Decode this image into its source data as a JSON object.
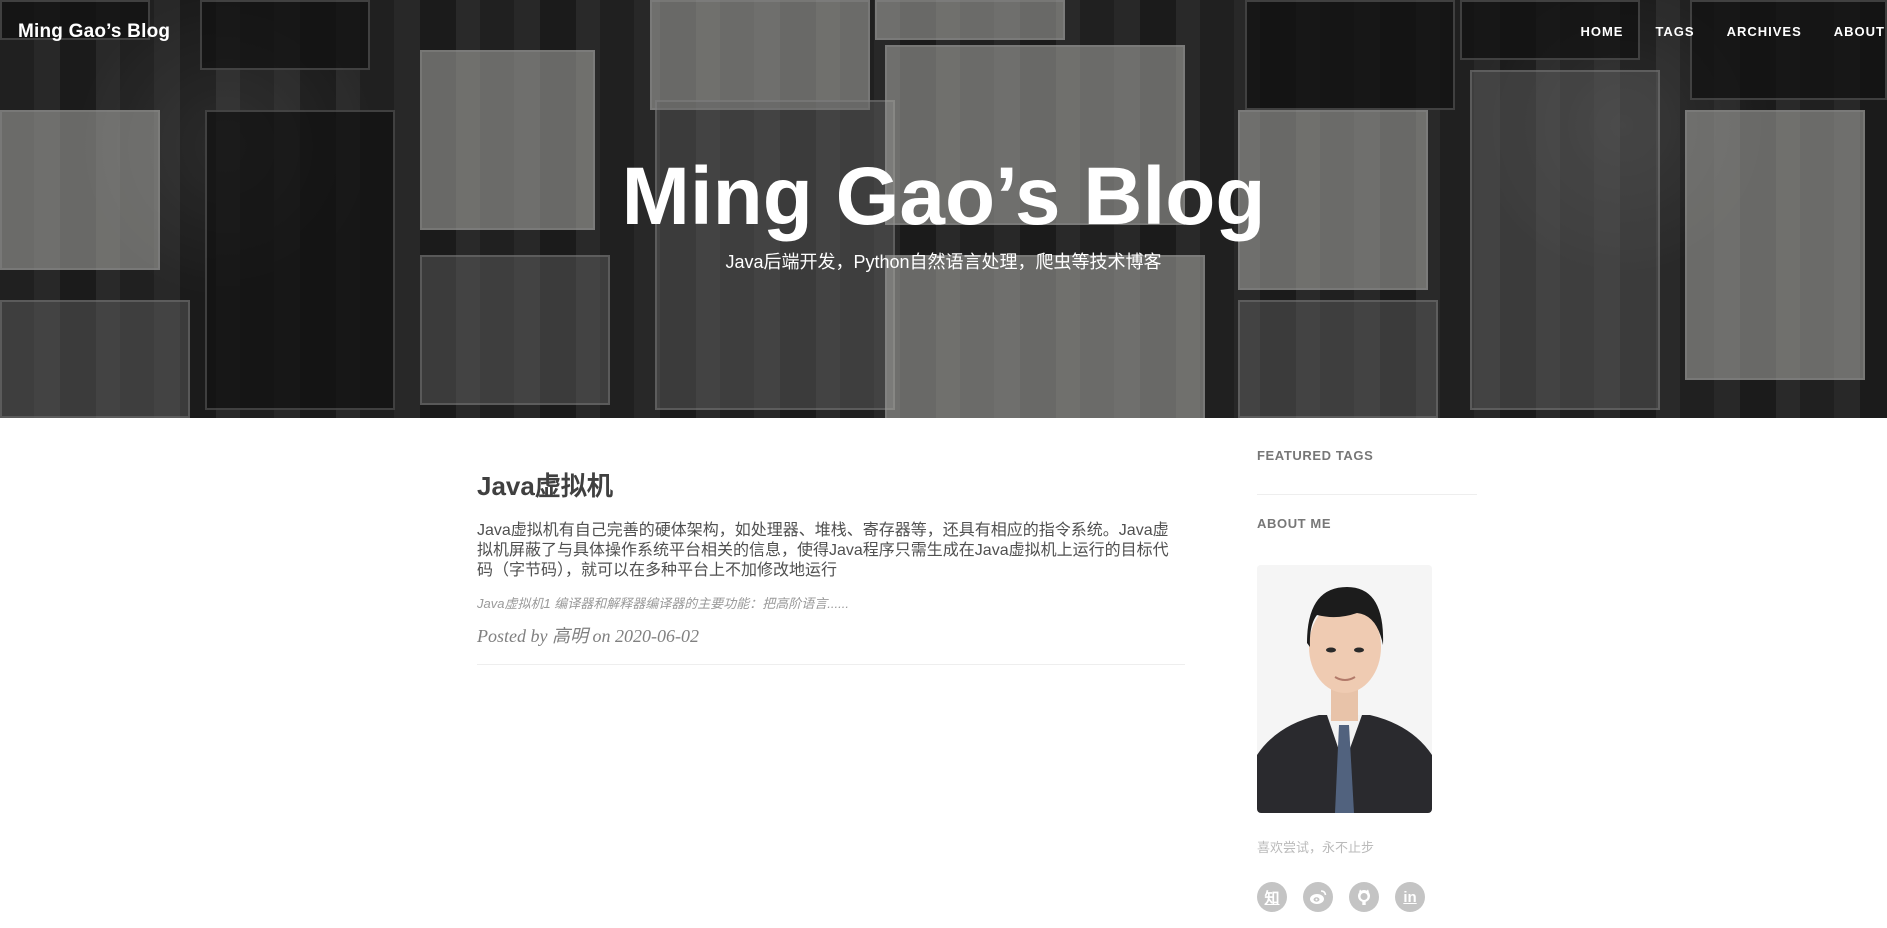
{
  "header": {
    "brand": "Ming Gao’s Blog",
    "nav": [
      "HOME",
      "TAGS",
      "ARCHIVES",
      "ABOUT"
    ],
    "title": "Ming Gao’s Blog",
    "subtitle": "Java后端开发，Python自然语言处理，爬虫等技术博客"
  },
  "post": {
    "title": "Java虚拟机",
    "excerpt": "Java虚拟机有自己完善的硬体架构，如处理器、堆栈、寄存器等，还具有相应的指令系统。Java虚拟机屏蔽了与具体操作系统平台相关的信息，使得Java程序只需生成在Java虚拟机上运行的目标代码（字节码），就可以在多种平台上不加修改地运行",
    "meta": "Java虚拟机1 编译器和解释器编译器的主要功能：把高阶语言......",
    "byline": "Posted by 高明 on 2020-06-02"
  },
  "sidebar": {
    "featured_tags": "FEATURED TAGS",
    "about_me": "ABOUT ME",
    "motto": "喜欢尝试，永不止步",
    "socials": [
      {
        "icon": "zhihu-icon",
        "glyph": "知"
      },
      {
        "icon": "weibo-icon",
        "glyph": ""
      },
      {
        "icon": "github-icon",
        "glyph": ""
      },
      {
        "icon": "linkedin-icon",
        "glyph": "in"
      }
    ]
  },
  "colors": {
    "social_bg": "#c4c4c4",
    "title": "#404040",
    "muted": "#9a9a9a"
  }
}
